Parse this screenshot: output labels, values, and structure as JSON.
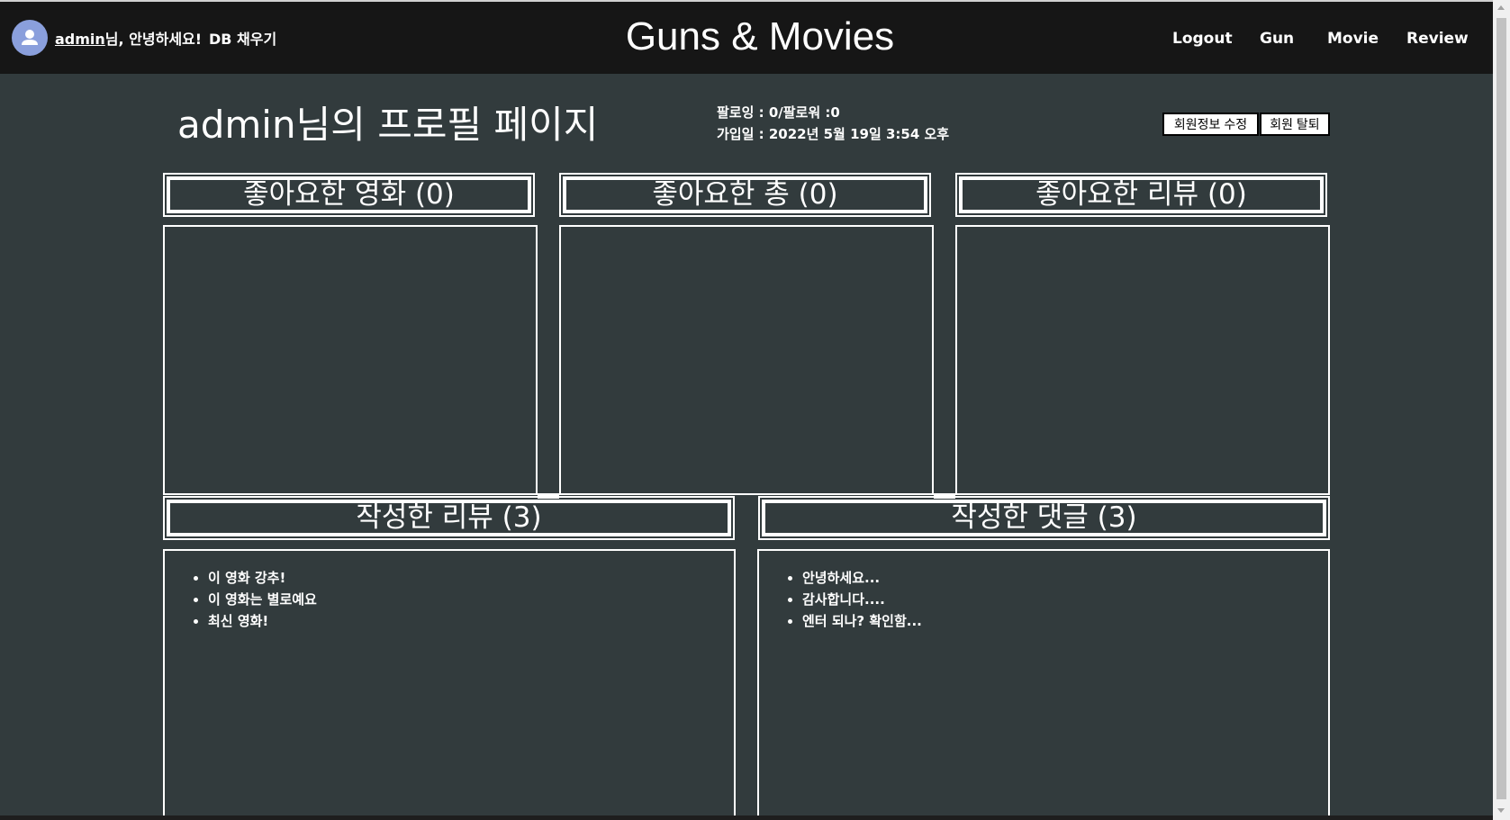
{
  "navbar": {
    "greeting_user": "admin",
    "greeting_suffix": "님, 안녕하세요!",
    "db_fill": "DB 채우기",
    "brand": "Guns & Movies",
    "links": [
      "Logout",
      "Gun",
      "Movie",
      "Review"
    ]
  },
  "profile": {
    "title": "admin님의 프로필 페이지",
    "follow_info": "팔로잉 : 0/팔로워 :0",
    "joined": "가입일 : 2022년 5월 19일 3:54 오후",
    "edit_button": "회원정보 수정",
    "delete_button": "회원 탈퇴"
  },
  "sections": {
    "liked_movies": {
      "title": "좋아요한 영화 (0)",
      "items": []
    },
    "liked_guns": {
      "title": "좋아요한 총 (0)",
      "items": []
    },
    "liked_reviews": {
      "title": "좋아요한 리뷰 (0)",
      "items": []
    },
    "my_reviews": {
      "title": "작성한 리뷰 (3)",
      "items": [
        "이 영화 강추!",
        "이 영화는 별로예요",
        "최신 영화!"
      ]
    },
    "my_comments": {
      "title": "작성한 댓글 (3)",
      "items": [
        "안녕하세요...",
        "감사합니다....",
        "엔터 되나? 확인함..."
      ]
    }
  }
}
